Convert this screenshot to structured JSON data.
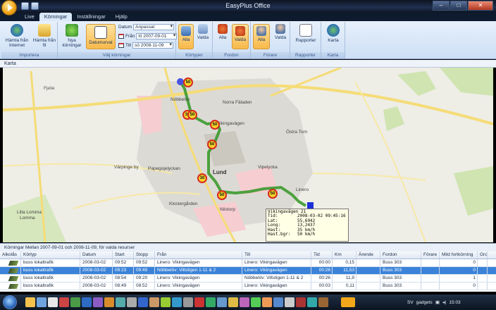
{
  "window": {
    "title": "EasyPlus Office"
  },
  "tabs": [
    "Live",
    "Körningar",
    "Inställningar",
    "Hjälp"
  ],
  "ribbon": {
    "importera": {
      "group": "Importera",
      "btn1": "Hämta från Internet",
      "btn2": "Hämta från fil"
    },
    "korningar": {
      "group": "Välj körningar",
      "btn_new": "Nya körningar",
      "btn_date": "Datumurval",
      "datum_label": "Datum",
      "datum_value": "Anpassat",
      "fran_label": "Från",
      "fran_value": "lö 2007-09-01",
      "till_label": "Till",
      "till_value": "sö 2008-11-09"
    },
    "kortyper": {
      "group": "Körtyper",
      "alla": "Alla",
      "valda": "Valda"
    },
    "fordon": {
      "group": "Fordon",
      "alla": "Alla",
      "valda": "Valda"
    },
    "forare": {
      "group": "Förare",
      "alla": "Alla",
      "valda": "Valda"
    },
    "rapporter": {
      "group": "Rapporter",
      "btn": "Rapporter"
    },
    "karta": {
      "group": "Karta",
      "btn": "Karta"
    }
  },
  "map": {
    "panel_title": "Karta",
    "labels": [
      "Fjelie",
      "Nöbbelöv",
      "Norra Fäladen",
      "Östra Torn",
      "Vipelycka",
      "Värpinge by",
      "Papegojelyckan",
      "Lund",
      "Linero",
      "Klostergården",
      "Nilstorp",
      "Lilla Lomma",
      "Lomma",
      "Vikingavägen"
    ],
    "speed_signs": [
      "50",
      "30",
      "50",
      "50",
      "50",
      "30",
      "50",
      "50"
    ],
    "info": {
      "title": "Vikingavägen 21",
      "rows": [
        {
          "k": "Tid:",
          "v": "2008-03-02 09:45:16"
        },
        {
          "k": "Lat:",
          "v": "55,6942"
        },
        {
          "k": "Long:",
          "v": "13,2437"
        },
        {
          "k": "Hast:",
          "v": "35 km/h"
        },
        {
          "k": "Hast.bgr:",
          "v": "50 km/h"
        }
      ]
    }
  },
  "caption": "Körningar Mellan 2007-09-01 och 2008-11-09, för valda resurser",
  "table": {
    "columns": [
      "Alkolås",
      "Körtyp",
      "Datum",
      "Start",
      "Stopp",
      "Från",
      "Till",
      "Tid",
      "Km",
      "Ärende",
      "Fordon",
      "Förare",
      "Mild fortkörning",
      "Gro"
    ],
    "rows": [
      [
        "",
        "buss lokaltrafik",
        "2008-03-02",
        "09:52",
        "09:52",
        "Linero: Vikingavägen",
        "Linero: Vikingavägen",
        "00:00",
        "0,15",
        "",
        "Buss 303",
        "",
        "0",
        ""
      ],
      [
        "",
        "buss lokaltrafik",
        "2008-03-02",
        "09:23",
        "09:49",
        "Nöbbelöv: Viltstigen 1-11 & 2",
        "Linero: Vikingavägen",
        "00:26",
        "11,53",
        "",
        "Buss 303",
        "",
        "0",
        ""
      ],
      [
        "",
        "buss lokaltrafik",
        "2008-03-02",
        "08:54",
        "09:20",
        "Linero: Vikingavägen",
        "Nöbbelöv: Viltstigen 1-11 & 2",
        "00:26",
        "11,9",
        "",
        "Buss 303",
        "",
        "1",
        ""
      ],
      [
        "",
        "buss lokaltrafik",
        "2008-03-02",
        "08:49",
        "08:52",
        "Linero: Vikingavägen",
        "Linero: Vikingavägen",
        "00:03",
        "0,11",
        "",
        "Buss 303",
        "",
        "0",
        ""
      ]
    ],
    "selected_row": 1
  },
  "taskbar": {
    "lang": "SV",
    "gadgets": "gadgets",
    "clock": "15:03"
  }
}
